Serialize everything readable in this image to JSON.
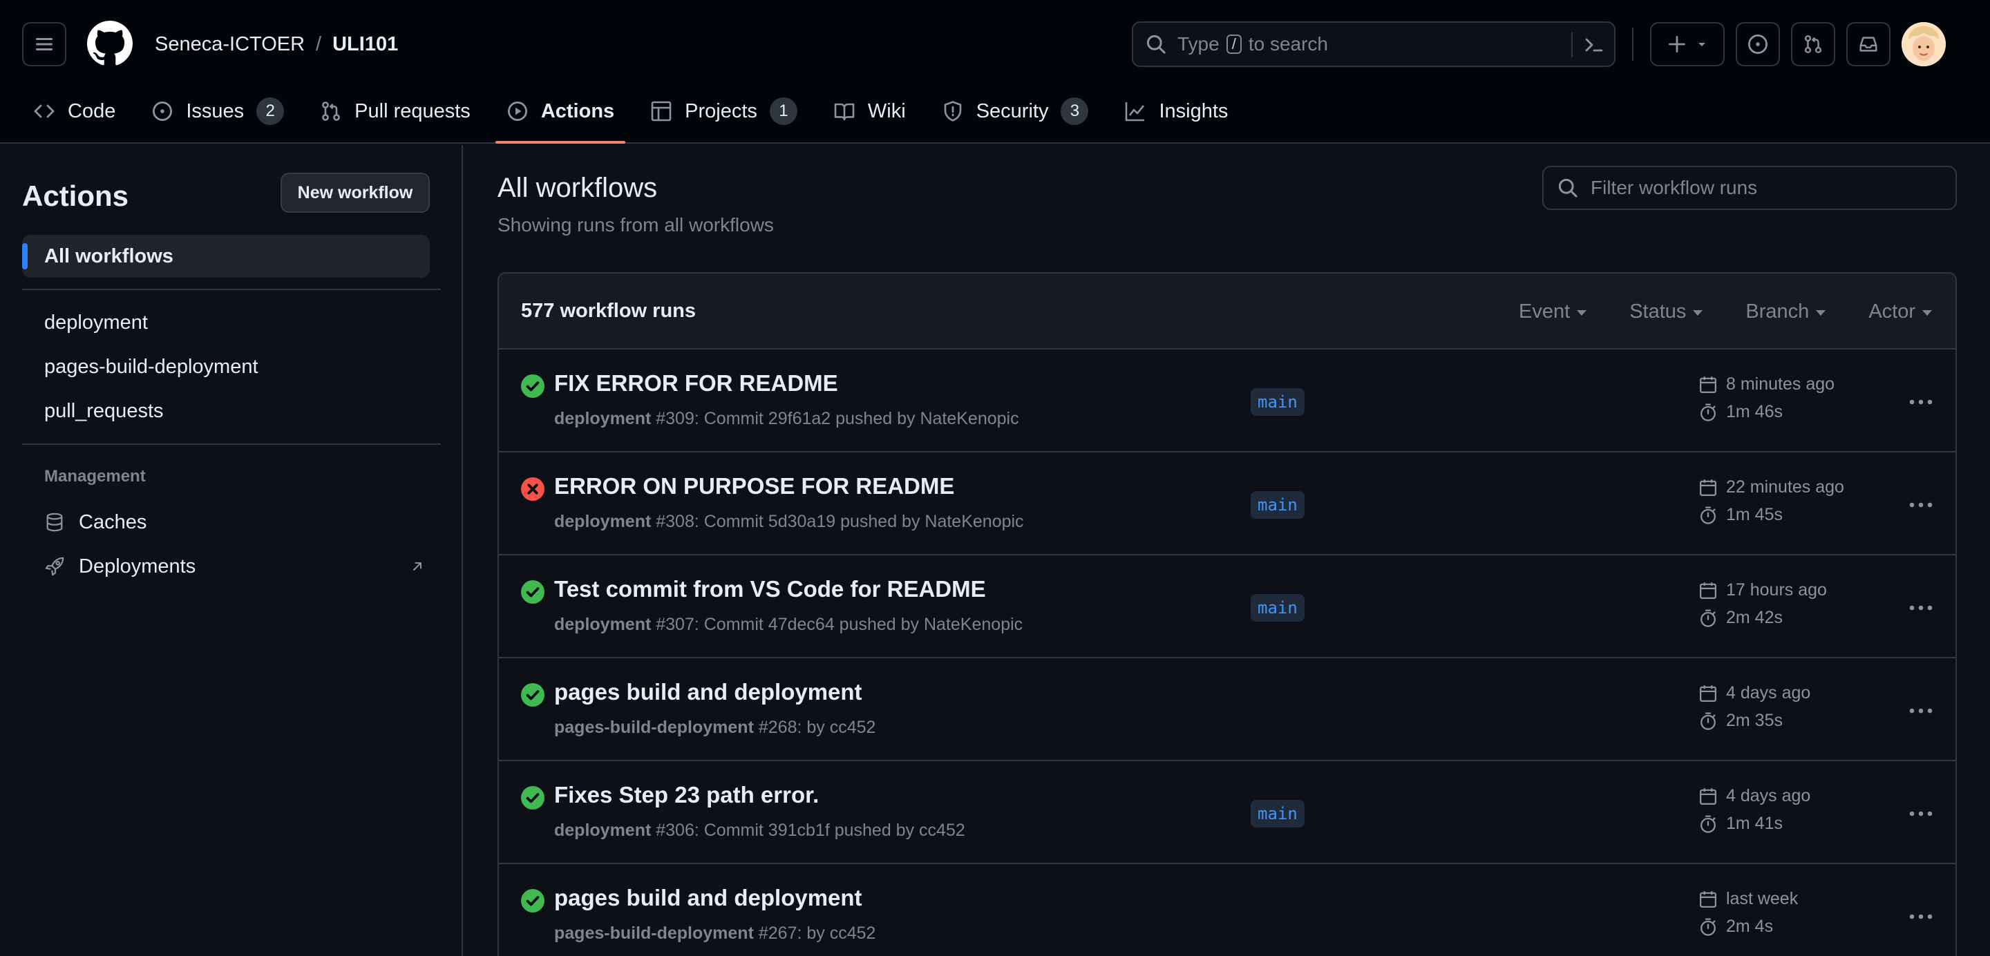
{
  "header": {
    "owner": "Seneca-ICTOER",
    "separator": "/",
    "repo": "ULI101",
    "search": {
      "prefix": "Type",
      "key": "/",
      "suffix": "to search"
    }
  },
  "nav": {
    "tabs": [
      {
        "label": "Code",
        "icon": "code-icon"
      },
      {
        "label": "Issues",
        "icon": "issue-icon",
        "count": "2"
      },
      {
        "label": "Pull requests",
        "icon": "pull-request-icon"
      },
      {
        "label": "Actions",
        "icon": "play-icon",
        "active": true
      },
      {
        "label": "Projects",
        "icon": "table-icon",
        "count": "1"
      },
      {
        "label": "Wiki",
        "icon": "book-icon"
      },
      {
        "label": "Security",
        "icon": "shield-icon",
        "count": "3"
      },
      {
        "label": "Insights",
        "icon": "graph-icon"
      }
    ]
  },
  "sidebar": {
    "title": "Actions",
    "new_workflow": "New workflow",
    "all_workflows": "All workflows",
    "workflows": [
      "deployment",
      "pages-build-deployment",
      "pull_requests"
    ],
    "management_heading": "Management",
    "caches": "Caches",
    "deployments": "Deployments"
  },
  "main": {
    "title": "All workflows",
    "subtitle": "Showing runs from all workflows",
    "filter_placeholder": "Filter workflow runs",
    "runs_count": "577 workflow runs",
    "filters": [
      "Event",
      "Status",
      "Branch",
      "Actor"
    ]
  },
  "runs": [
    {
      "status": "success",
      "title": "FIX ERROR FOR README",
      "workflow": "deployment",
      "detail": "#309: Commit 29f61a2 pushed by NateKenopic",
      "branch": "main",
      "when": "8 minutes ago",
      "duration": "1m 46s"
    },
    {
      "status": "failure",
      "title": "ERROR ON PURPOSE FOR README",
      "workflow": "deployment",
      "detail": "#308: Commit 5d30a19 pushed by NateKenopic",
      "branch": "main",
      "when": "22 minutes ago",
      "duration": "1m 45s"
    },
    {
      "status": "success",
      "title": "Test commit from VS Code for README",
      "workflow": "deployment",
      "detail": "#307: Commit 47dec64 pushed by NateKenopic",
      "branch": "main",
      "when": "17 hours ago",
      "duration": "2m 42s"
    },
    {
      "status": "success",
      "title": "pages build and deployment",
      "workflow": "pages-build-deployment",
      "detail": "#268: by cc452",
      "branch": "",
      "when": "4 days ago",
      "duration": "2m 35s"
    },
    {
      "status": "success",
      "title": "Fixes Step 23 path error.",
      "workflow": "deployment",
      "detail": "#306: Commit 391cb1f pushed by cc452",
      "branch": "main",
      "when": "4 days ago",
      "duration": "1m 41s"
    },
    {
      "status": "success",
      "title": "pages build and deployment",
      "workflow": "pages-build-deployment",
      "detail": "#267: by cc452",
      "branch": "",
      "when": "last week",
      "duration": "2m 4s"
    }
  ],
  "colors": {
    "success": "#3fb950",
    "failure": "#f85149",
    "accent": "#2f81f7",
    "active_tab": "#f78166"
  }
}
